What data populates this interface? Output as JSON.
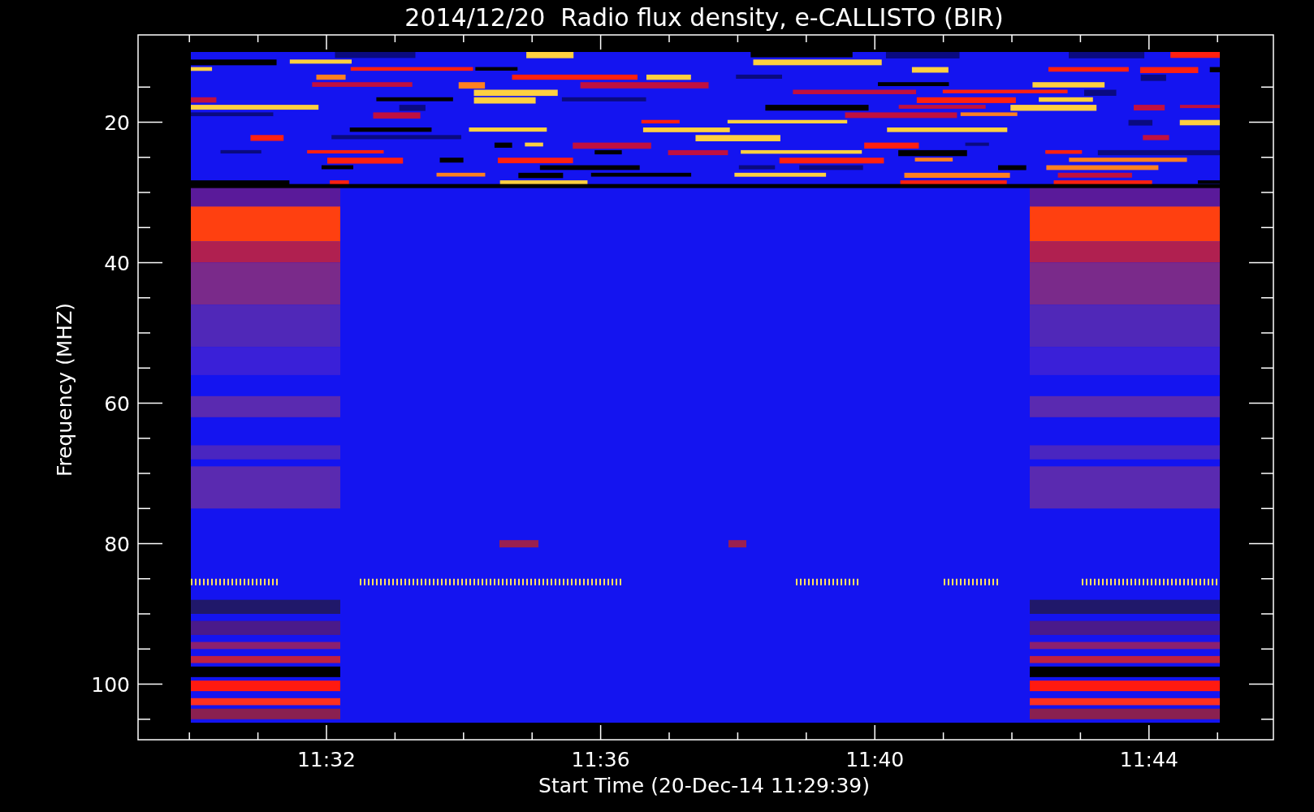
{
  "plot": {
    "title": "2014/12/20  Radio flux density, e-CALLISTO (BIR)",
    "ylabel": "Frequency (MHZ)",
    "xlabel": "Start Time (20-Dec-14 11:29:39)",
    "yticks": [
      "20",
      "40",
      "60",
      "80",
      "100"
    ],
    "xticks": [
      "11:32",
      "11:36",
      "11:40",
      "11:44"
    ]
  }
}
